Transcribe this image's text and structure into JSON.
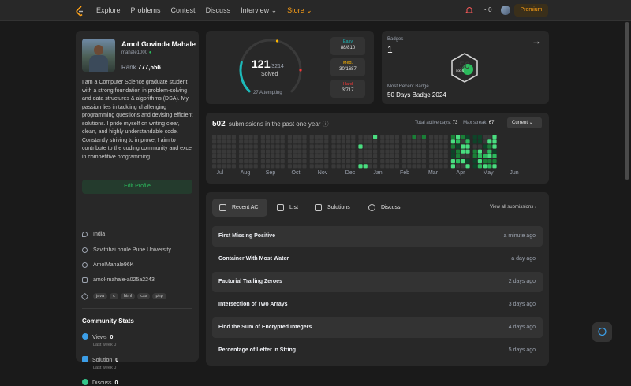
{
  "nav": {
    "items": [
      "Explore",
      "Problems",
      "Contest",
      "Discuss",
      "Interview ⌄",
      "Store ⌄"
    ],
    "streak": "0",
    "premium": "Premium"
  },
  "profile": {
    "name": "Amol Govinda Mahale",
    "username": "mahale1000",
    "rank_label": "Rank",
    "rank": "777,556",
    "bio": "I am a Computer Science graduate student with a strong foundation in problem-solving and data structures & algorithms (DSA). My passion lies in tackling challenging programming questions and devising efficient solutions. I pride myself on writing clear, clean, and highly understandable code. Constantly striving to improve, I aim to contribute to the coding community and excel in competitive programming.",
    "edit": "Edit Profile",
    "location": "India",
    "university": "Savitribai phule Pune University",
    "github": "AmolMahale96K",
    "linkedin": "amol-mahale-a025a2243",
    "tags": [
      "java",
      "c",
      "html",
      "css",
      "php"
    ]
  },
  "community": {
    "title": "Community Stats",
    "views_label": "Views",
    "views": "0",
    "solution_label": "Solution",
    "solution": "0",
    "discuss_label": "Discuss",
    "discuss": "0",
    "lastweek": "Last week 0",
    "colors": {
      "views": "#3c9ee7",
      "solution": "#2cbb5d",
      "discuss": "#34c58a"
    }
  },
  "solved": {
    "count": "121",
    "total": "/3214",
    "label": "Solved",
    "attempting": "27 Attempting",
    "fraction": 0.0376,
    "easy_label": "Easy",
    "easy": "88/810",
    "med_label": "Med.",
    "med": "30/1687",
    "hard_label": "Hard",
    "hard": "3/717",
    "colors": {
      "easy": "#1cbaba",
      "med": "#ffb700",
      "hard": "#f63737"
    }
  },
  "badges": {
    "title": "Badges",
    "count": "1",
    "badge_text": "50DS",
    "recent_label": "Most Recent Badge",
    "recent": "50 Days Badge 2024"
  },
  "submissions": {
    "count": "502",
    "text": "submissions in the past one year",
    "active_label": "Total active days:",
    "active": "73",
    "streak_label": "Max streak:",
    "streak": "67",
    "period": "Current ⌄",
    "months": [
      "Jul",
      "Aug",
      "Sep",
      "Oct",
      "Nov",
      "Dec",
      "Jan",
      "Feb",
      "Mar",
      "Apr",
      "May",
      "Jun"
    ]
  },
  "recent": {
    "tabs": [
      "Recent AC",
      "List",
      "Solutions",
      "Discuss"
    ],
    "view_all": "View all submissions ›",
    "rows": [
      {
        "title": "First Missing Positive",
        "time": "a minute ago"
      },
      {
        "title": "Container With Most Water",
        "time": "a day ago"
      },
      {
        "title": "Factorial Trailing Zeroes",
        "time": "2 days ago"
      },
      {
        "title": "Intersection of Two Arrays",
        "time": "3 days ago"
      },
      {
        "title": "Find the Sum of Encrypted Integers",
        "time": "4 days ago"
      },
      {
        "title": "Percentage of Letter in String",
        "time": "5 days ago"
      }
    ]
  }
}
